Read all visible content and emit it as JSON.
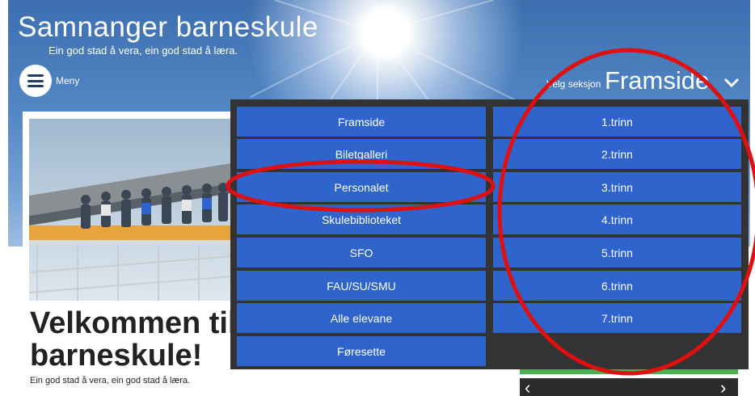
{
  "header": {
    "title": "Samnanger barneskule",
    "tagline": "Ein god stad å vera, ein god stad å læra.",
    "menu_label": "Meny",
    "section_label": "Velg seksjon",
    "section_value": "Framside"
  },
  "dropdown": {
    "left_items": [
      "Framside",
      "Biletgalleri",
      "Personalet",
      "Skulebiblioteket",
      "SFO",
      "FAU/SU/SMU",
      "Alle elevane",
      "Føresette"
    ],
    "right_items": [
      "1.trinn",
      "2.trinn",
      "3.trinn",
      "4.trinn",
      "5.trinn",
      "6.trinn",
      "7.trinn"
    ]
  },
  "content": {
    "welcome_heading": "Velkommen til barneskule!",
    "welcome_subtitle": "Ein god stad å vera, ein god stad å læra."
  },
  "colors": {
    "menu_item_bg": "#2f64cc",
    "dropdown_bg": "#333333",
    "annotation_red": "#e01010"
  },
  "icons": {
    "menu": "hamburger-icon",
    "section_select": "chevron-down-icon",
    "widget_prev": "chevron-left-icon",
    "widget_next": "chevron-right-icon"
  }
}
